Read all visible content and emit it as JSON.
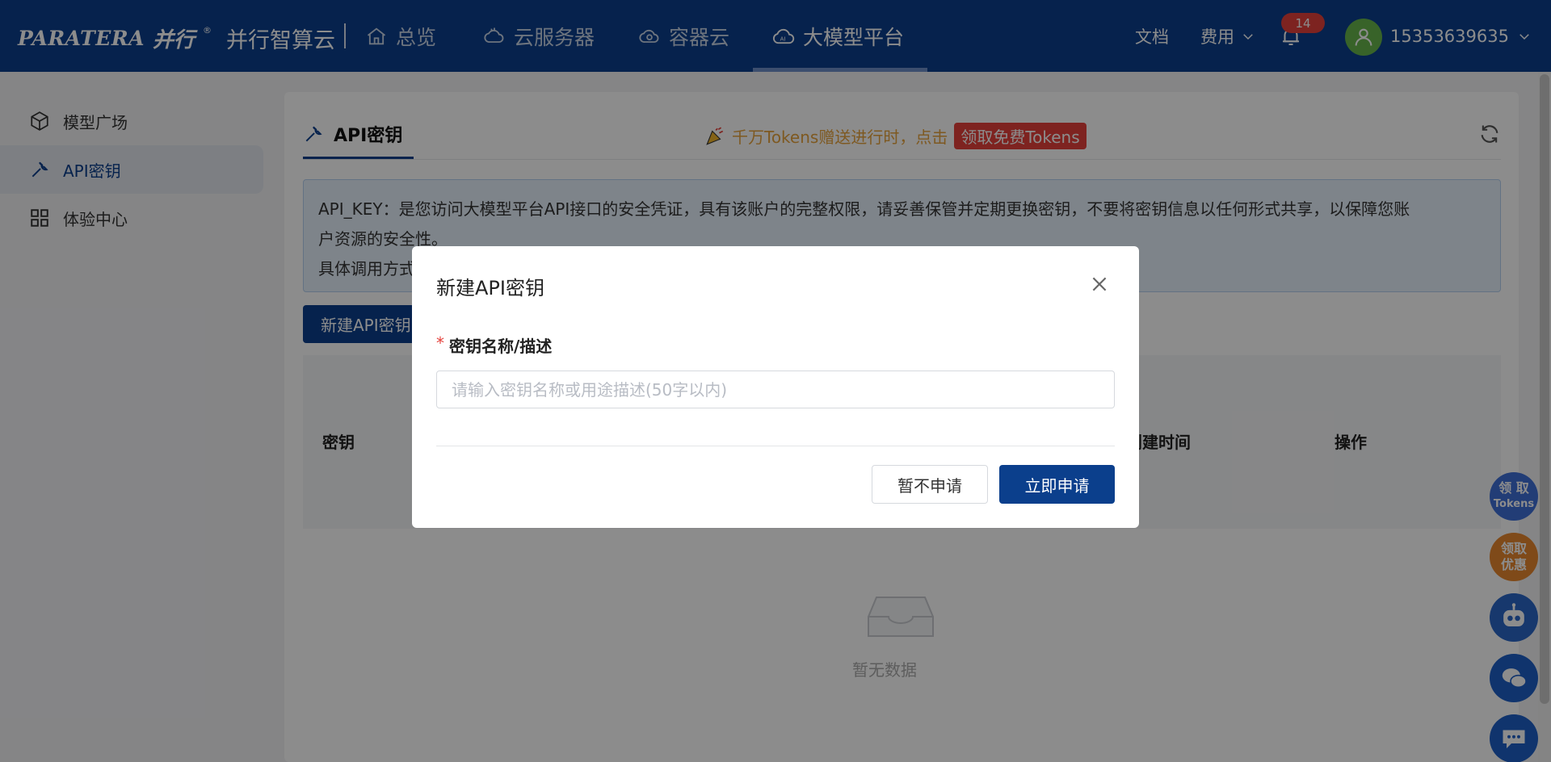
{
  "topbar": {
    "logo_en": "PARATERA",
    "logo_cn": "并行",
    "logo_reg": "®",
    "product": "并行智算云",
    "nav": [
      {
        "label": "总览",
        "icon": "home-icon"
      },
      {
        "label": "云服务器",
        "icon": "cloud-server-icon"
      },
      {
        "label": "容器云",
        "icon": "container-cloud-icon"
      },
      {
        "label": "大模型平台",
        "icon": "ai-cloud-icon",
        "active": true
      }
    ],
    "docs": "文档",
    "fees": "费用",
    "notification_count": "14",
    "username": "15353639635"
  },
  "sidebar": {
    "items": [
      {
        "label": "模型广场",
        "icon": "cube-icon"
      },
      {
        "label": "API密钥",
        "icon": "wrench-icon",
        "active": true
      },
      {
        "label": "体验中心",
        "icon": "grid-icon"
      }
    ]
  },
  "main": {
    "tab_title": "API密钥",
    "promo_text": "千万Tokens赠送进行时，点击",
    "promo_button": "领取免费Tokens",
    "notice_line1": "API_KEY：是您访问大模型平台API接口的安全凭证，具有该账户的完整权限，请妥善保管并定期更换密钥，不要将密钥信息以任何形式共享，以保障您账",
    "notice_line2": "户资源的安全性。",
    "notice_line3": "具体调用方式",
    "create_button": "新建API密钥",
    "columns": {
      "key": "密钥",
      "created": "创建时间",
      "actions": "操作"
    },
    "empty_text": "暂无数据"
  },
  "floating": {
    "tokens_line1": "领 取",
    "tokens_line2": "Tokens",
    "discount_line1": "领取",
    "discount_line2": "优惠"
  },
  "modal": {
    "title": "新建API密钥",
    "required_mark": "*",
    "field_label": "密钥名称/描述",
    "field_placeholder": "请输入密钥名称或用途描述(50字以内)",
    "field_value": "",
    "cancel": "暂不申请",
    "submit": "立即申请"
  },
  "colors": {
    "brand": "#0b3f8c",
    "danger": "#e5413b",
    "promo": "#e6a23c"
  }
}
